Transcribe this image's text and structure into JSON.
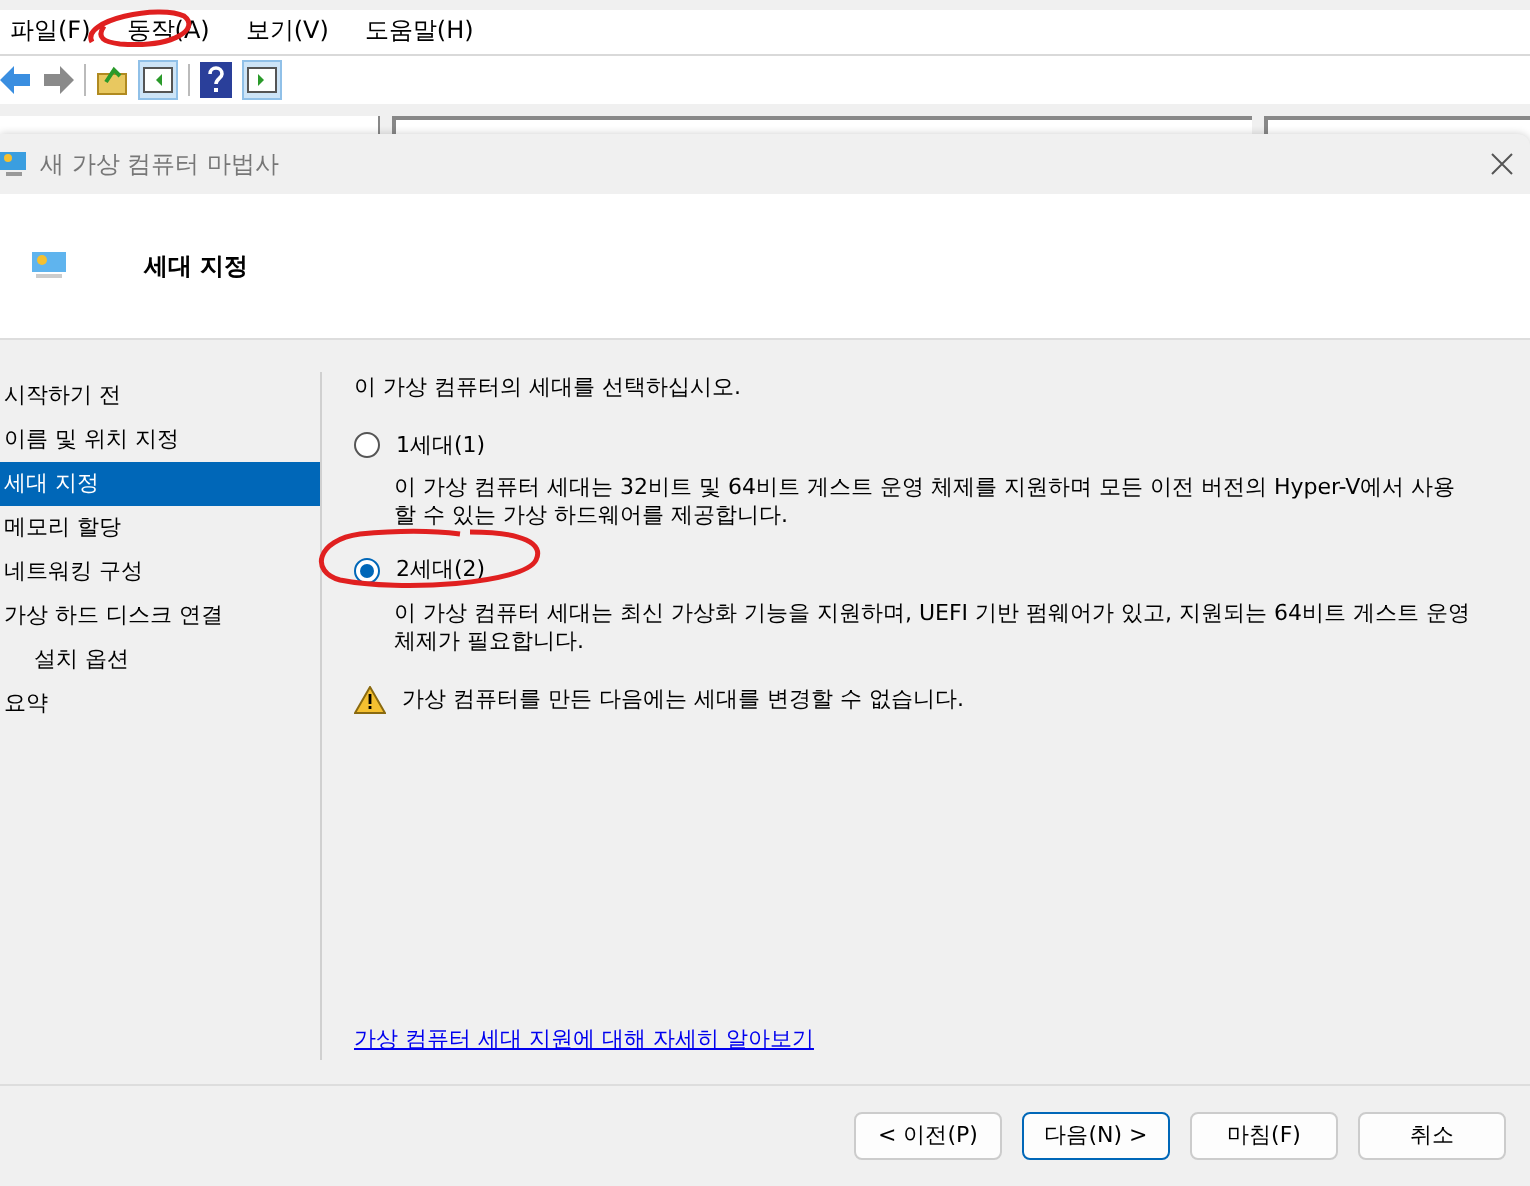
{
  "menu_bar": [
    "파일(F)",
    "동작(A)",
    "보기(V)",
    "도움말(H)"
  ],
  "dialog": {
    "title": "새 가상 컴퓨터 마법사",
    "header": "세대 지정",
    "steps": [
      {
        "label": "시작하기 전",
        "selected": false
      },
      {
        "label": "이름 및 위치 지정",
        "selected": false
      },
      {
        "label": "세대 지정",
        "selected": true
      },
      {
        "label": "메모리 할당",
        "selected": false
      },
      {
        "label": "네트워킹 구성",
        "selected": false
      },
      {
        "label": "가상 하드 디스크 연결",
        "selected": false,
        "children": [
          {
            "label": "설치 옵션",
            "selected": false
          }
        ]
      },
      {
        "label": "요약",
        "selected": false
      }
    ],
    "prompt": "이 가상 컴퓨터의 세대를 선택하십시오.",
    "options": [
      {
        "label": "1세대(1)",
        "selected": false,
        "description": "이 가상 컴퓨터 세대는 32비트 및 64비트 게스트 운영 체제를 지원하며 모든 이전 버전의 Hyper-V에서 사용할 수 있는 가상 하드웨어를 제공합니다."
      },
      {
        "label": "2세대(2)",
        "selected": true,
        "description": "이 가상 컴퓨터 세대는 최신 가상화 기능을 지원하며, UEFI 기반 펌웨어가 있고, 지원되는 64비트 게스트 운영 체제가 필요합니다."
      }
    ],
    "warning": "가상 컴퓨터를 만든 다음에는 세대를 변경할 수 없습니다.",
    "link": "가상 컴퓨터 세대 지원에 대해 자세히 알아보기",
    "buttons": [
      {
        "label": "< 이전(P)",
        "default": false
      },
      {
        "label": "다음(N) >",
        "default": true
      },
      {
        "label": "마침(F)",
        "default": false
      },
      {
        "label": "취소",
        "default": false
      }
    ]
  }
}
